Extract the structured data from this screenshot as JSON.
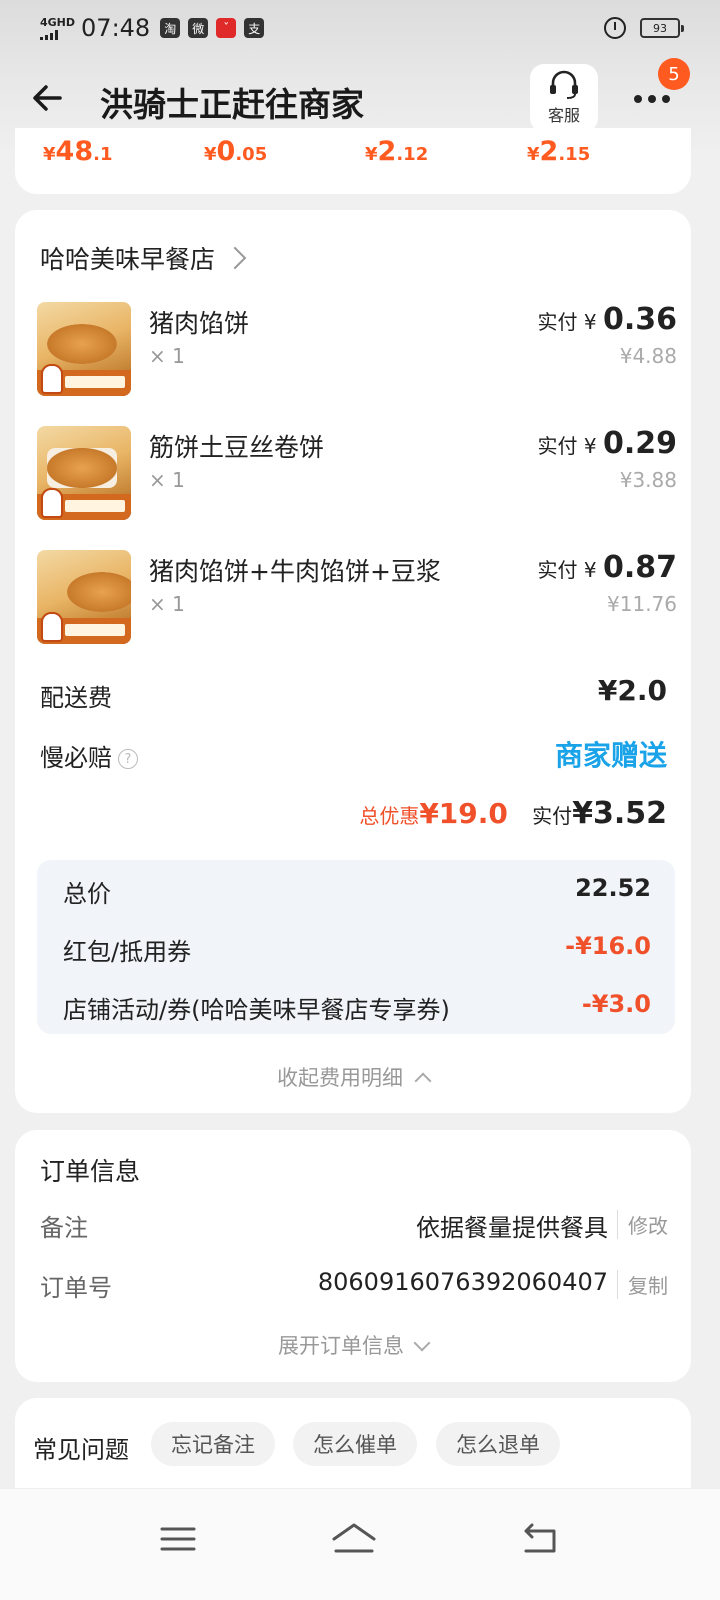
{
  "status_bar": {
    "network": "4GHD",
    "time": "07:48",
    "app_icons": [
      "淘",
      "微",
      "ˇ",
      "支"
    ],
    "battery": "93"
  },
  "header": {
    "title": "洪骑士正赶往商家",
    "customer_service_label": "客服",
    "badge_count": "5"
  },
  "top_prices": [
    {
      "yen": "¥",
      "int": "48",
      "dec": ".1"
    },
    {
      "yen": "¥",
      "int": "0",
      "dec": ".05"
    },
    {
      "yen": "¥",
      "int": "2",
      "dec": ".12"
    },
    {
      "yen": "¥",
      "int": "2",
      "dec": ".15"
    }
  ],
  "order": {
    "shop_name": "哈哈美味早餐店",
    "items": [
      {
        "name": "猪肉馅饼",
        "qty": "× 1",
        "paid_label": "实付 ¥ ",
        "paid": "0.36",
        "original": "¥4.88"
      },
      {
        "name": "筋饼土豆丝卷饼",
        "qty": "× 1",
        "paid_label": "实付 ¥ ",
        "paid": "0.29",
        "original": "¥3.88"
      },
      {
        "name": "猪肉馅饼+牛肉馅饼+豆浆",
        "qty": "× 1",
        "paid_label": "实付 ¥ ",
        "paid": "0.87",
        "original": "¥11.76"
      }
    ],
    "delivery_fee_label": "配送费",
    "delivery_fee": "¥2.0",
    "slow_compensation_label": "慢必赔",
    "slow_compensation_value": "商家赠送",
    "total_discount_label": "总优惠",
    "total_discount": "¥19.0",
    "actual_paid_label": "实付",
    "actual_paid": "¥3.52",
    "fee_details": [
      {
        "label": "总价",
        "value": "22.52"
      },
      {
        "label": "红包/抵用券",
        "value": "-¥16.0"
      },
      {
        "label": "店铺活动/券(哈哈美味早餐店专享券)",
        "value": "-¥3.0"
      }
    ],
    "collapse_label": "收起费用明细"
  },
  "order_info": {
    "title": "订单信息",
    "remark_label": "备注",
    "remark_value": "依据餐量提供餐具",
    "remark_action": "修改",
    "order_no_label": "订单号",
    "order_no_value": "8060916076392060407",
    "order_no_action": "复制",
    "expand_label": "展开订单信息"
  },
  "faq": {
    "title": "常见问题",
    "chips": [
      "忘记备注",
      "怎么催单",
      "怎么退单"
    ]
  },
  "colors": {
    "accent_orange": "#ff5a1f",
    "discount_red": "#f0502a",
    "blue_link": "#1aa3e8"
  }
}
